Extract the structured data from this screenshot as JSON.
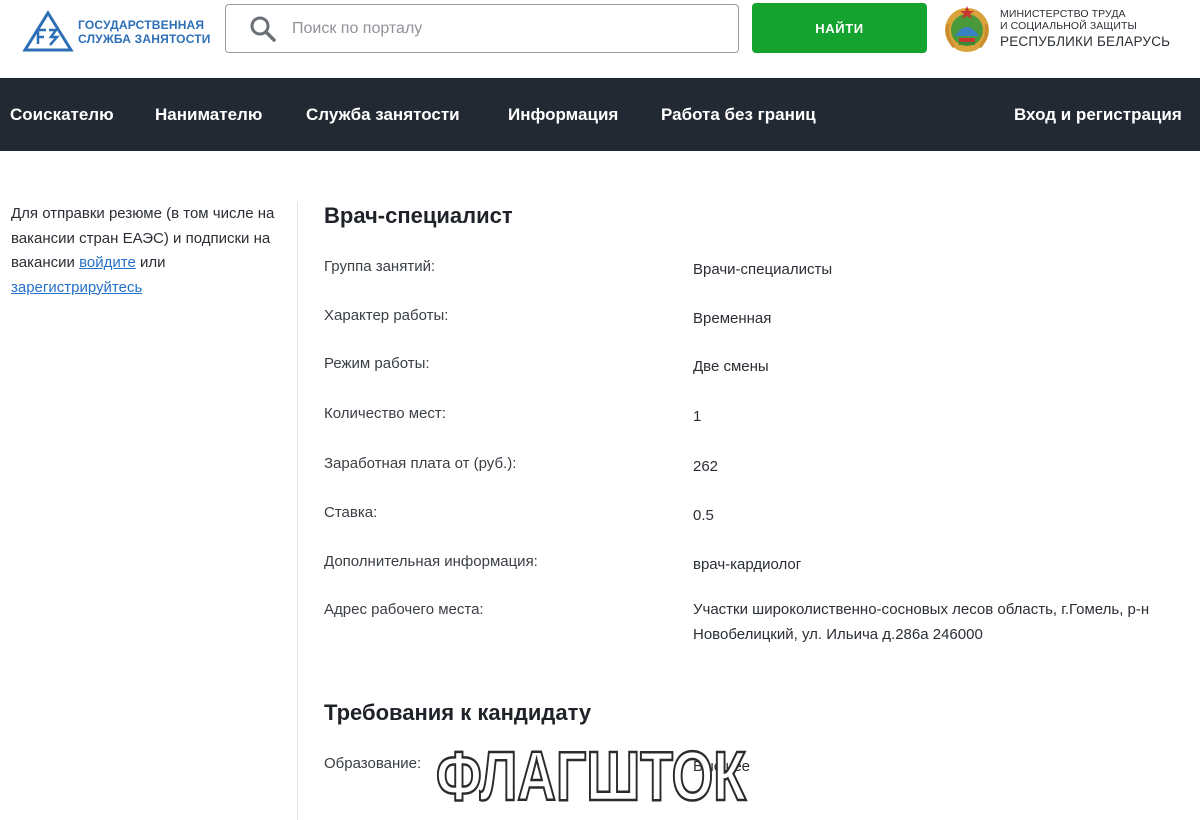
{
  "header": {
    "logo": {
      "line1": "ГОСУДАРСТВЕННАЯ",
      "line2": "СЛУЖБА ЗАНЯТОСТИ",
      "icon": "gsz-logo-icon"
    },
    "search": {
      "placeholder": "Поиск по порталу",
      "value": "",
      "icon": "search-icon"
    },
    "find_button": "НАЙТИ",
    "ministry": {
      "line1": "МИНИСТЕРСТВО ТРУДА",
      "line2": "И СОЦИАЛЬНОЙ ЗАЩИТЫ",
      "line3": "РЕСПУБЛИКИ БЕЛАРУСЬ",
      "icon": "belarus-emblem-icon"
    }
  },
  "nav": {
    "items": [
      "Соискателю",
      "Нанимателю",
      "Служба занятости",
      "Информация",
      "Работа без границ"
    ],
    "login": "Вход и регистрация"
  },
  "sidebar": {
    "text_before": "Для отправки резюме (в том числе на вакансии стран ЕАЭС) и подписки на вакансии ",
    "login_link": "войдите",
    "text_middle": " или ",
    "register_link": "зарегистрируйтесь"
  },
  "vacancy": {
    "title": "Врач-специалист",
    "fields": [
      {
        "label": "Группа занятий:",
        "value": "Врачи-специалисты"
      },
      {
        "label": "Характер работы:",
        "value": "Временная"
      },
      {
        "label": "Режим работы:",
        "value": "Две смены"
      },
      {
        "label": "Количество мест:",
        "value": "1"
      },
      {
        "label": "Заработная плата от (руб.):",
        "value": "262"
      },
      {
        "label": "Ставка:",
        "value": "0.5"
      },
      {
        "label": "Дополнительная информация:",
        "value": "врач-кардиолог"
      },
      {
        "label": "Адрес рабочего места:",
        "value": "Участки широколиственно-сосновых лесов область, г.Гомель, р-н Новобелицкий, ул. Ильича д.286а 246000"
      }
    ]
  },
  "requirements": {
    "title": "Требования к кандидату",
    "fields": [
      {
        "label": "Образование:",
        "value": "Высшее"
      }
    ]
  },
  "watermark": {
    "text": "ФЛАГШТОК"
  },
  "colors": {
    "nav_bg": "#232932",
    "button_green": "#15a32f",
    "link_blue": "#2672c9",
    "logo_blue": "#2d6fb6"
  }
}
